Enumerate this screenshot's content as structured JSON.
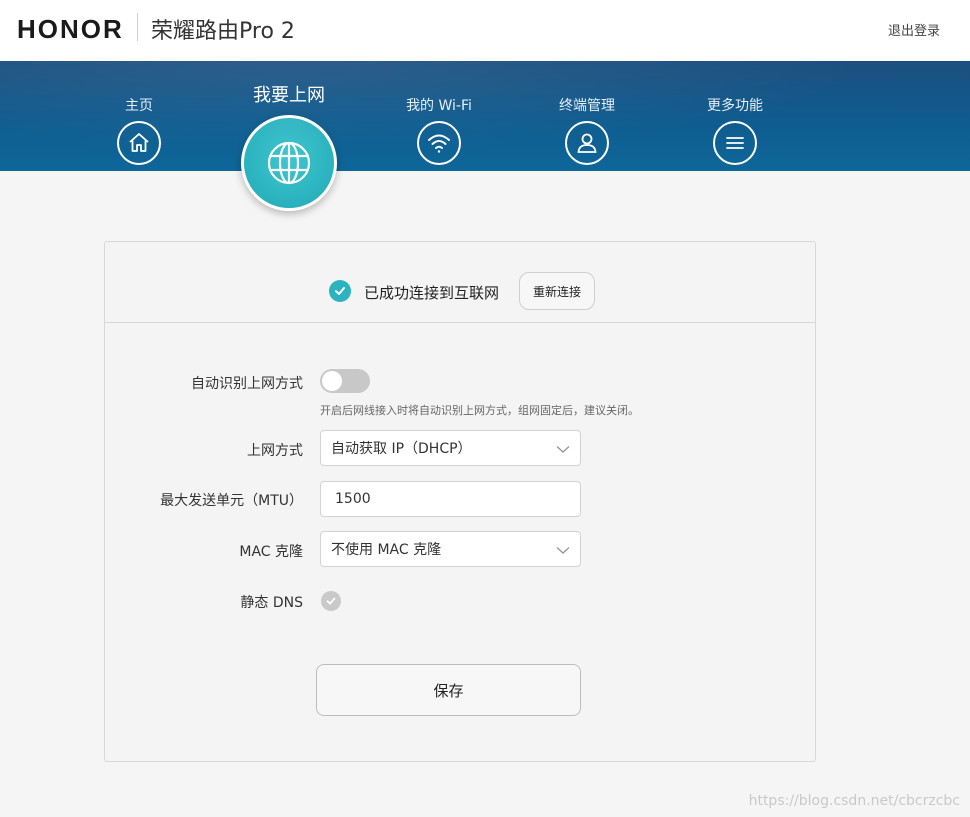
{
  "header": {
    "brand": "HONOR",
    "product": "荣耀路由Pro 2",
    "logout_label": "退出登录"
  },
  "nav": {
    "items": [
      {
        "label": "主页",
        "icon": "home-icon"
      },
      {
        "label": "我要上网",
        "icon": "globe-icon",
        "active": true
      },
      {
        "label": "我的 Wi-Fi",
        "icon": "wifi-icon"
      },
      {
        "label": "终端管理",
        "icon": "user-icon"
      },
      {
        "label": "更多功能",
        "icon": "menu-icon"
      }
    ]
  },
  "status": {
    "text": "已成功连接到互联网",
    "reconnect_label": "重新连接"
  },
  "form": {
    "auto_detect": {
      "label": "自动识别上网方式",
      "enabled": false,
      "hint": "开启后网线接入时将自动识别上网方式，组网固定后，建议关闭。"
    },
    "connection_type": {
      "label": "上网方式",
      "value": "自动获取 IP（DHCP）"
    },
    "mtu": {
      "label": "最大发送单元（MTU）",
      "value": "1500"
    },
    "mac_clone": {
      "label": "MAC 克隆",
      "value": "不使用 MAC 克隆"
    },
    "static_dns": {
      "label": "静态 DNS",
      "checked": false
    },
    "save_label": "保存"
  },
  "watermark": "https://blog.csdn.net/cbcrzcbc",
  "colors": {
    "accent": "#2bb3c0",
    "nav_band": "#0f5c8f"
  }
}
